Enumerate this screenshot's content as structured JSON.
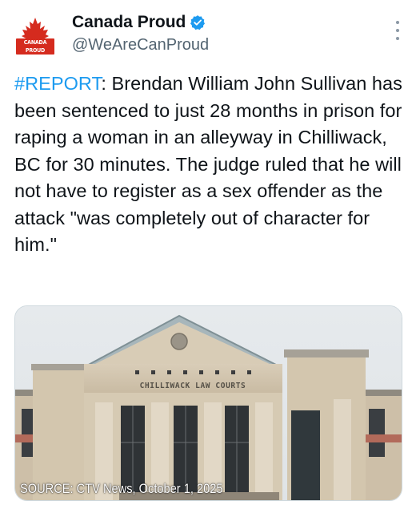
{
  "account": {
    "display_name": "Canada Proud",
    "handle": "@WeAreCanProud",
    "verified": true,
    "avatar_text": "CANADA PROUD"
  },
  "tweet": {
    "hashtag": "#REPORT",
    "body": ": Brendan William John Sullivan has been sentenced to just 28 months in prison for raping a woman in an alleyway in Chilliwack, BC for 30 minutes. The judge ruled that he will not have to register as a sex offender as the attack \"was completely out of character for him.\""
  },
  "media": {
    "building_sign": "CHILLIWACK LAW COURTS",
    "source_caption": "SOURCE: CTV News, October 1, 2025"
  },
  "colors": {
    "hashtag": "#1d9bf0",
    "verified_badge": "#1d9bf0",
    "handle": "#536471",
    "brand_red": "#d52b1e"
  },
  "icons": {
    "avatar": "maple-leaf-icon",
    "verified": "verified-badge-icon",
    "more": "more-vertical-icon"
  }
}
